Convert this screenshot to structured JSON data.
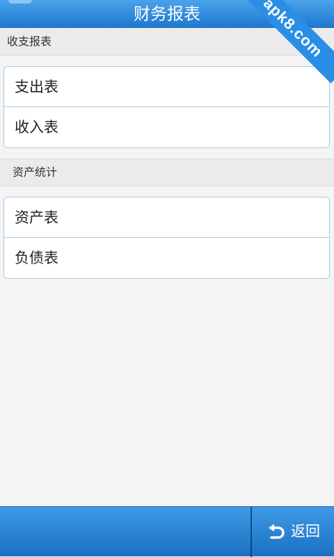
{
  "header": {
    "title": "财务报表",
    "watermark": "apk8.com"
  },
  "sections": [
    {
      "label": "收支报表",
      "items": [
        "支出表",
        "收入表"
      ]
    },
    {
      "label": "资产统计",
      "items": [
        "资产表",
        "负债表"
      ]
    }
  ],
  "footer": {
    "back_label": "返回"
  },
  "colors": {
    "bar_blue": "#1e78cf",
    "group_border": "#a9cbe6",
    "page_bg": "#f4f4f4"
  }
}
